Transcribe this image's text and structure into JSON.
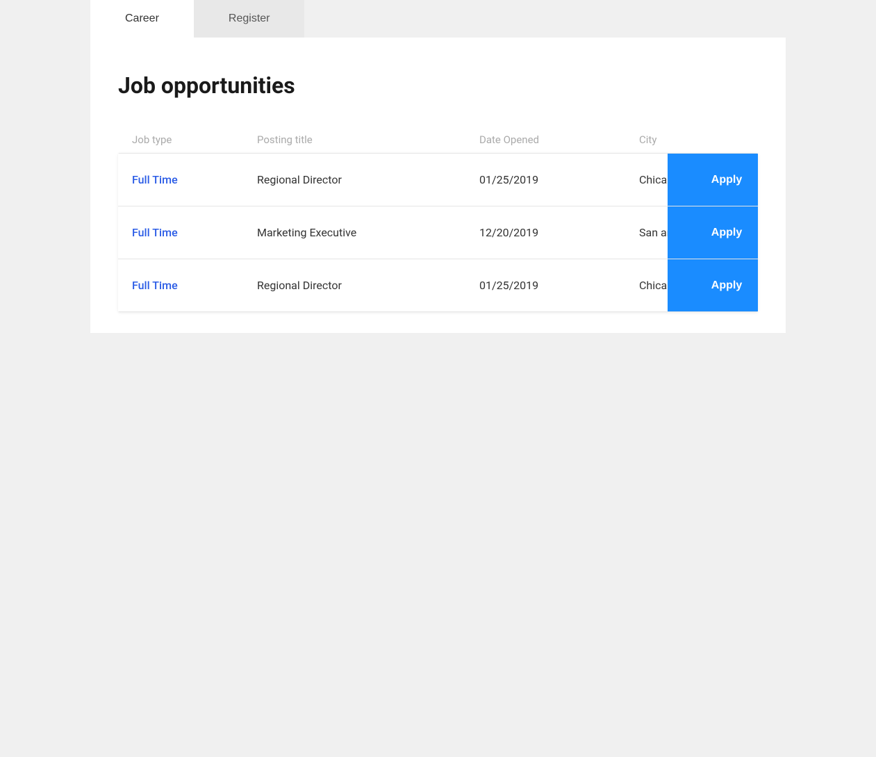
{
  "tabs": [
    {
      "id": "career",
      "label": "Career",
      "active": true
    },
    {
      "id": "register",
      "label": "Register",
      "active": false
    }
  ],
  "page": {
    "title": "Job opportunities"
  },
  "table": {
    "headers": {
      "job_type": "Job type",
      "posting_title": "Posting title",
      "date_opened": "Date Opened",
      "city": "City"
    },
    "rows": [
      {
        "job_type": "Full Time",
        "posting_title": "Regional Director",
        "date_opened": "01/25/2019",
        "city": "Chicago",
        "apply_label": "Apply"
      },
      {
        "job_type": "Full Time",
        "posting_title": "Marketing Executive",
        "date_opened": "12/20/2019",
        "city": "San antonio",
        "apply_label": "Apply"
      },
      {
        "job_type": "Full Time",
        "posting_title": "Regional Director",
        "date_opened": "01/25/2019",
        "city": "Chicago",
        "apply_label": "Apply"
      }
    ]
  },
  "colors": {
    "accent_blue": "#2b5ce6",
    "apply_blue": "#1a8cff",
    "header_text": "#aaaaaa",
    "body_text": "#333333",
    "tab_active_bg": "#ffffff",
    "tab_inactive_bg": "#e8e8e8"
  }
}
